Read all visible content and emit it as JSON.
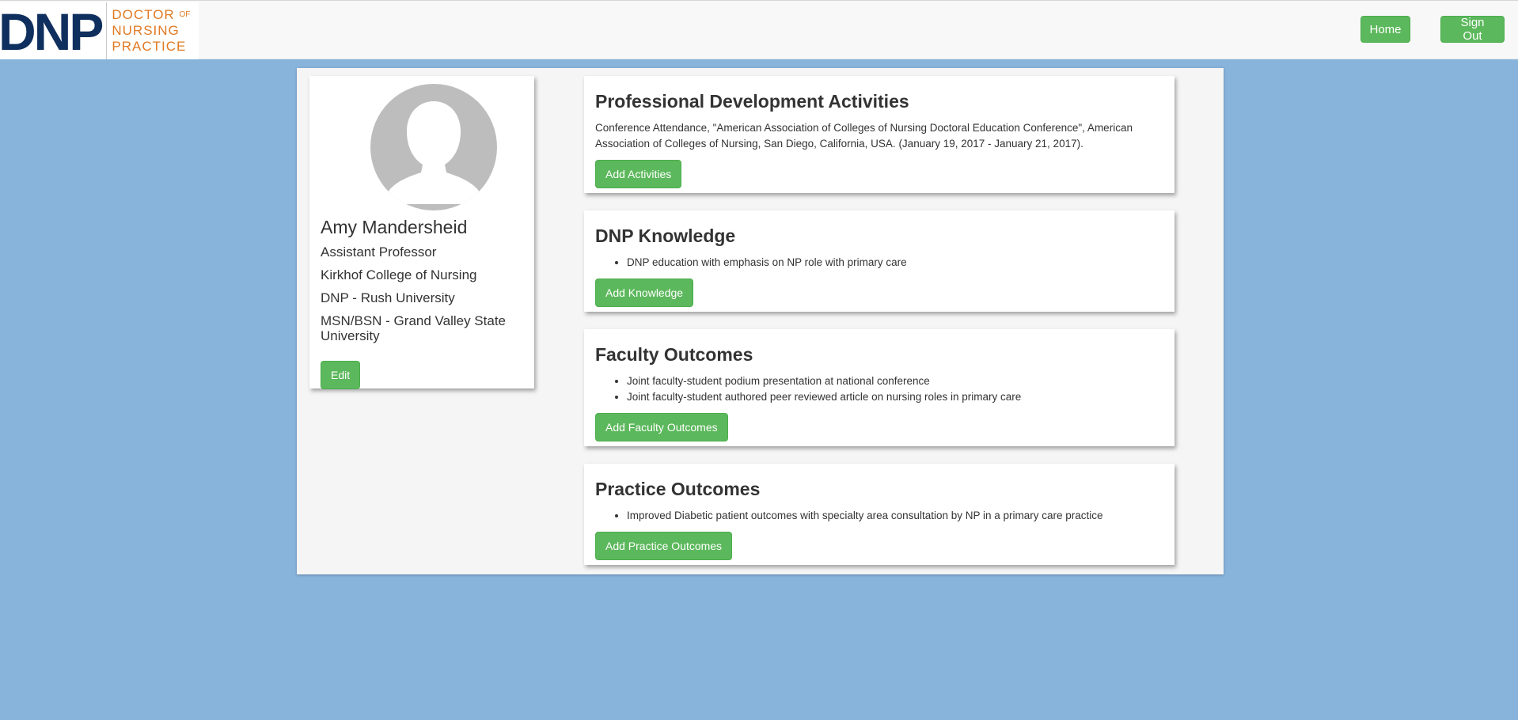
{
  "header": {
    "logo_mark": "DNP",
    "logo_line1": "DOCTOR",
    "logo_of": "OF",
    "logo_line2": "NURSING",
    "logo_line3": "PRACTICE",
    "home_label": "Home",
    "signout_label": "Sign Out"
  },
  "profile": {
    "name": "Amy Mandersheid",
    "title": "Assistant Professor",
    "college": "Kirkhof College of Nursing",
    "degree1": "DNP - Rush University",
    "degree2": "MSN/BSN - Grand Valley State University",
    "edit_label": "Edit"
  },
  "sections": {
    "activities": {
      "title": "Professional Development Activities",
      "text": "Conference Attendance, \"American Association of Colleges of Nursing Doctoral Education Conference\", American Association of Colleges of Nursing, San Diego, California, USA. (January 19, 2017 - January 21, 2017).",
      "button": "Add Activities"
    },
    "knowledge": {
      "title": "DNP Knowledge",
      "items": [
        "DNP education with emphasis on NP role with primary care"
      ],
      "button": "Add Knowledge"
    },
    "faculty": {
      "title": "Faculty Outcomes",
      "items": [
        "Joint faculty-student podium presentation at national conference",
        "Joint faculty-student authored peer reviewed article on nursing roles in primary care"
      ],
      "button": "Add Faculty Outcomes"
    },
    "practice": {
      "title": "Practice Outcomes",
      "items": [
        "Improved Diabetic patient outcomes with specialty area consultation by NP in a primary care practice"
      ],
      "button": "Add Practice Outcomes"
    }
  },
  "colors": {
    "background": "#88b3db",
    "accent_green": "#5cb85c",
    "logo_navy": "#0f2f5e",
    "logo_orange": "#e07a24"
  }
}
